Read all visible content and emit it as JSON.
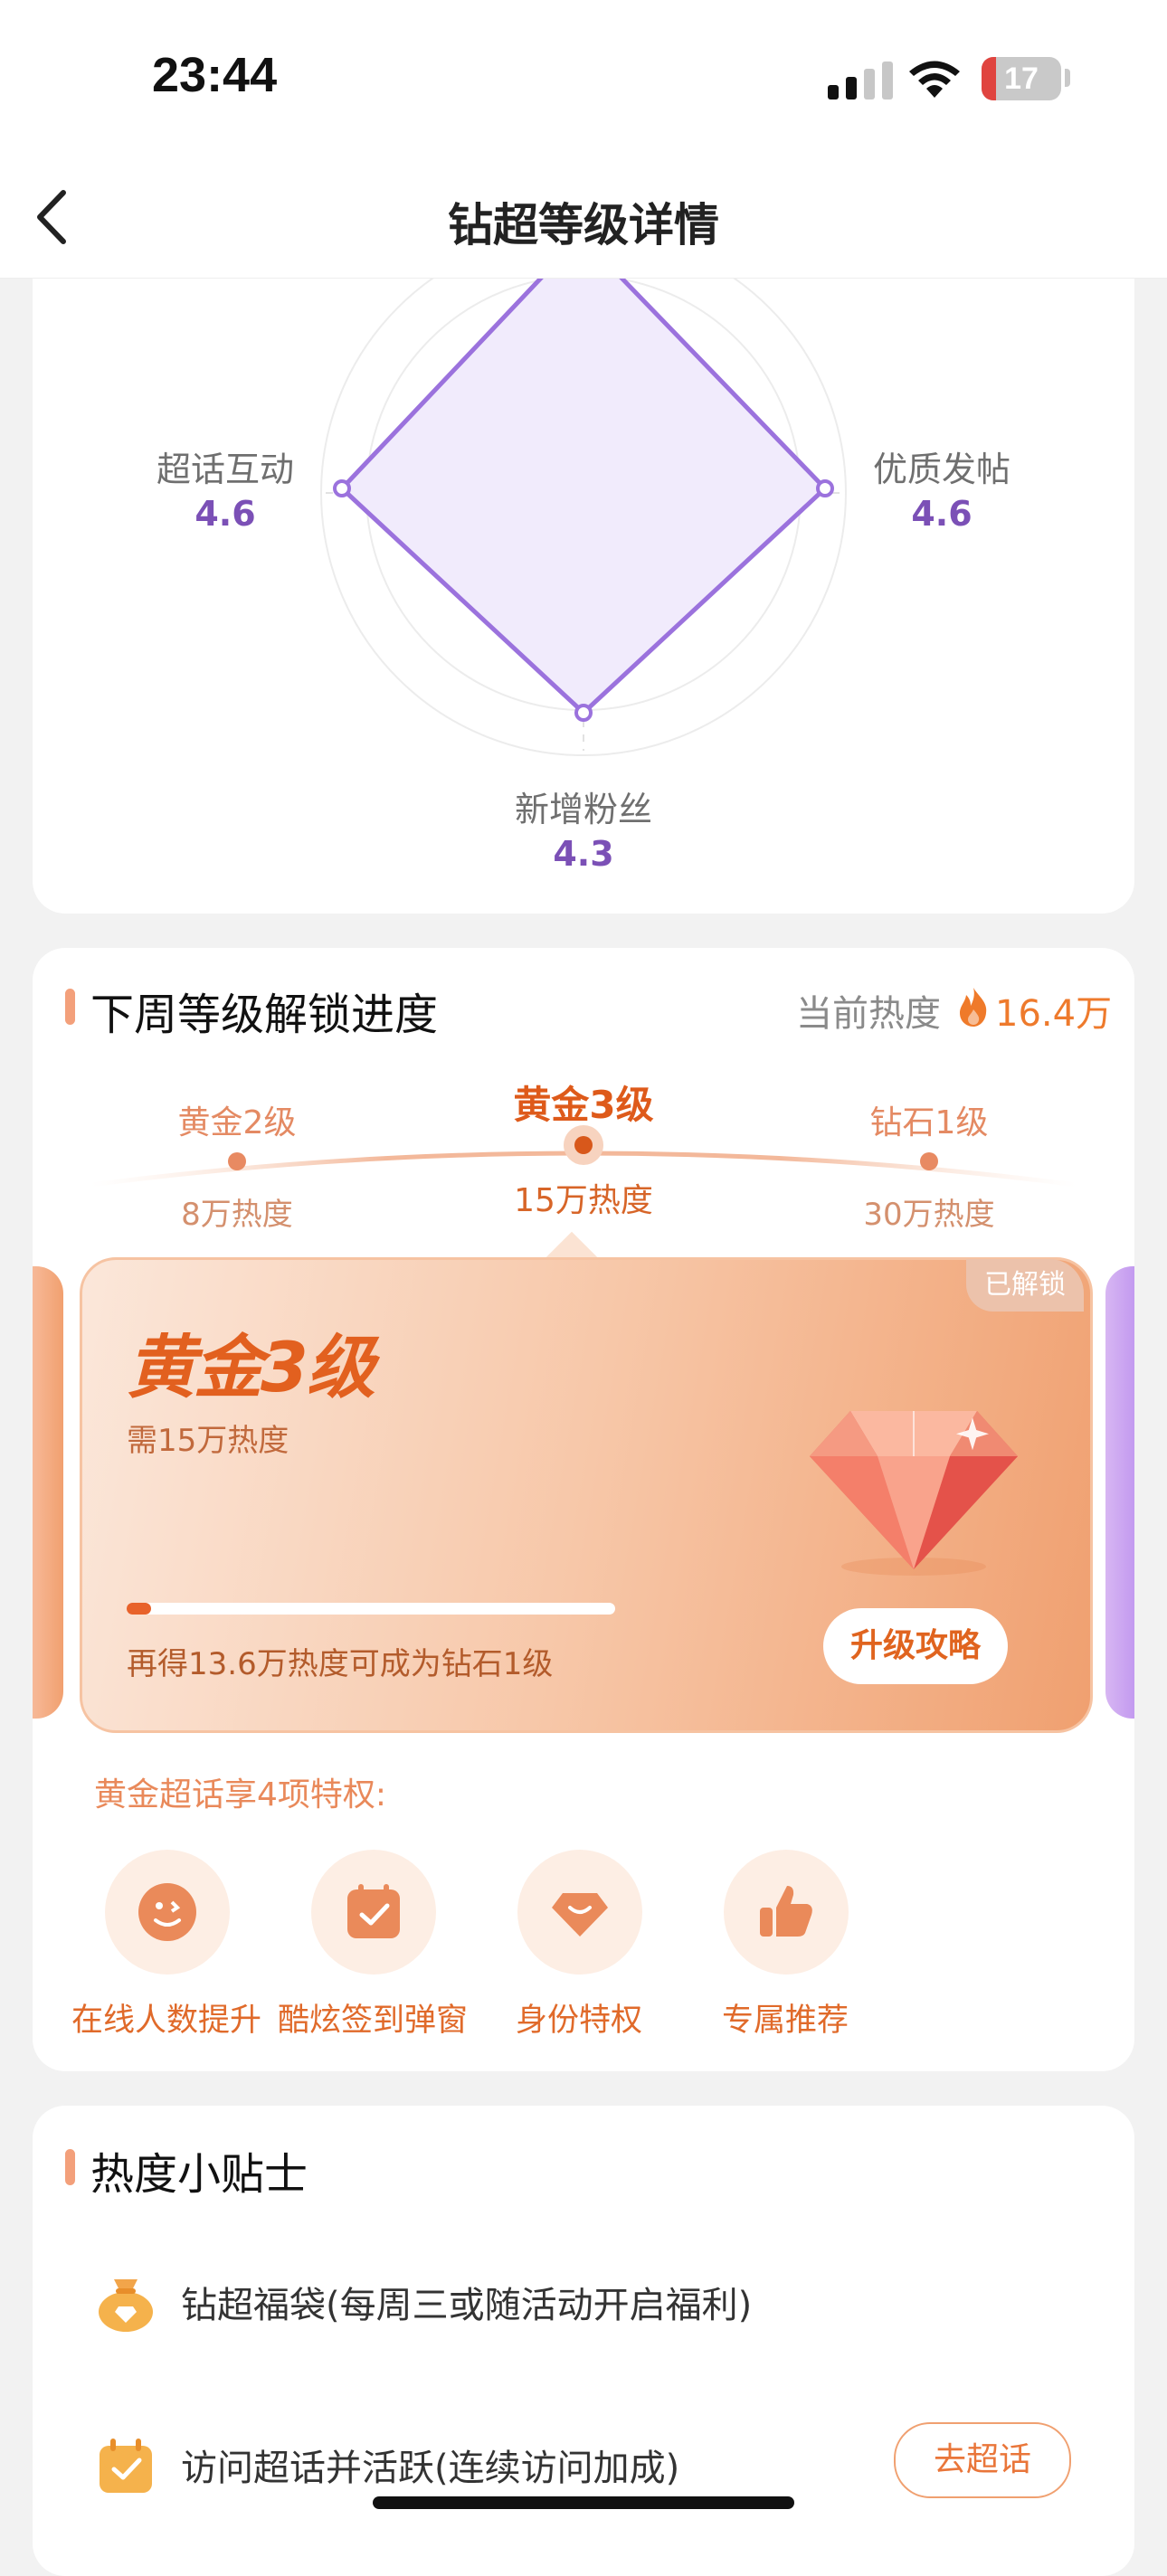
{
  "status_bar": {
    "time": "23:44",
    "battery": "17"
  },
  "nav": {
    "title": "钻超等级详情"
  },
  "radar": {
    "axes": [
      {
        "label": "超话互动",
        "value": "4.6"
      },
      {
        "label": "优质发帖",
        "value": "4.6"
      },
      {
        "label": "新增粉丝",
        "value": "4.3"
      }
    ],
    "colors": {
      "line": "#9b72dd",
      "fill": "#efe8fb"
    }
  },
  "unlock": {
    "title": "下周等级解锁进度",
    "current_heat_label": "当前热度",
    "current_heat_value": "16.4万",
    "levels": [
      {
        "name": "黄金2级",
        "heat": "8万热度"
      },
      {
        "name": "黄金3级",
        "heat": "15万热度"
      },
      {
        "name": "钻石1级",
        "heat": "30万热度"
      }
    ],
    "active_index": 1,
    "card": {
      "badge": "已解锁",
      "level": "黄金3级",
      "need": "需15万热度",
      "progress_fraction": 0.05,
      "tip": "再得13.6万热度可成为钻石1级",
      "button": "升级攻略"
    },
    "privileges_title": "黄金超话享4项特权:",
    "privileges": [
      {
        "label": "在线人数提升",
        "icon": "smile-face-icon"
      },
      {
        "label": "酷炫签到弹窗",
        "icon": "calendar-check-icon"
      },
      {
        "label": "身份特权",
        "icon": "diamond-badge-icon"
      },
      {
        "label": "专属推荐",
        "icon": "thumbs-up-icon"
      }
    ]
  },
  "tips": {
    "title": "热度小贴士",
    "items": [
      {
        "text": "钻超福袋(每周三或随活动开启福利)",
        "icon": "lucky-bag-icon"
      },
      {
        "text": "访问超话并活跃(连续访问加成)",
        "icon": "calendar-check-icon",
        "button": "去超话"
      }
    ]
  },
  "accent_colors": {
    "orange": "#e2601f",
    "purple": "#7b50b6"
  }
}
